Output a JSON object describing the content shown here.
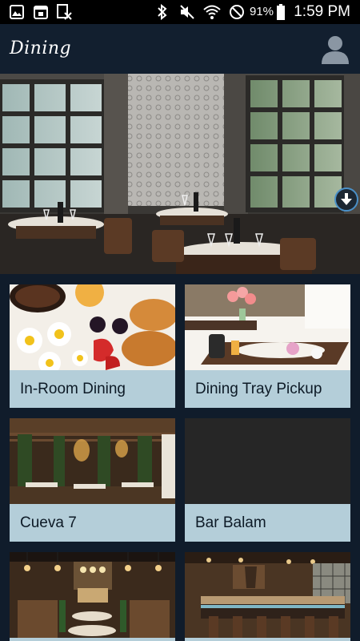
{
  "status_bar": {
    "battery": "91%",
    "time": "1:59 PM",
    "icons": [
      "image-icon",
      "calendar-icon",
      "sim-card-off-icon",
      "bluetooth-icon",
      "mute-icon",
      "wifi-icon",
      "do-not-disturb-icon",
      "battery-icon"
    ]
  },
  "header": {
    "title": "Dining",
    "avatar_icon": "user-profile-icon"
  },
  "hero": {
    "image": "restaurant-dining-room",
    "scroll_icon": "arrow-down-icon",
    "accent_color": "#4a90c8"
  },
  "tiles": [
    {
      "label": "In-Room Dining",
      "image": "breakfast-croissant-berries-flowers"
    },
    {
      "label": "Dining Tray Pickup",
      "image": "room-service-tray-on-bed"
    },
    {
      "label": "Cueva 7",
      "image": "garden-pergola-restaurant"
    },
    {
      "label": "Bar Balam",
      "image": ""
    },
    {
      "label": "",
      "image": "restaurant-with-chandeliers"
    },
    {
      "label": "",
      "image": "bar-with-stools"
    }
  ],
  "colors": {
    "background": "#101c2b",
    "tile_label_bg": "#b4ced9"
  }
}
